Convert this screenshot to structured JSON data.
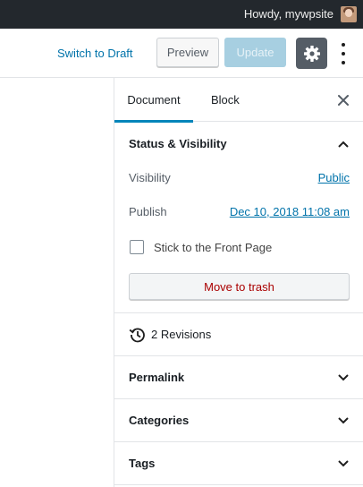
{
  "adminbar": {
    "greeting": "Howdy, mywpsite"
  },
  "toolbar": {
    "switch_to_draft": "Switch to Draft",
    "preview_label": "Preview",
    "update_label": "Update"
  },
  "sidebar": {
    "tabs": [
      {
        "label": "Document",
        "active": true
      },
      {
        "label": "Block",
        "active": false
      }
    ],
    "status_visibility": {
      "title": "Status & Visibility",
      "visibility_label": "Visibility",
      "visibility_value": "Public",
      "publish_label": "Publish",
      "publish_value": "Dec 10, 2018 11:08 am",
      "sticky_label": "Stick to the Front Page",
      "sticky_checked": false,
      "trash_label": "Move to trash"
    },
    "revisions": {
      "label": "2 Revisions"
    },
    "sections": [
      {
        "title": "Permalink"
      },
      {
        "title": "Categories"
      },
      {
        "title": "Tags"
      }
    ]
  },
  "colors": {
    "adminbar_bg": "#23282d",
    "link": "#0073aa",
    "active_tab": "#0085ba",
    "update_disabled": "#a7cfe1",
    "settings_bg": "#555d66",
    "trash_text": "#aa0000"
  },
  "icons": [
    "avatar",
    "gear-icon",
    "more-vertical-icon",
    "close-icon",
    "chevron-up-icon",
    "chevron-down-icon",
    "history-icon",
    "checkbox"
  ]
}
